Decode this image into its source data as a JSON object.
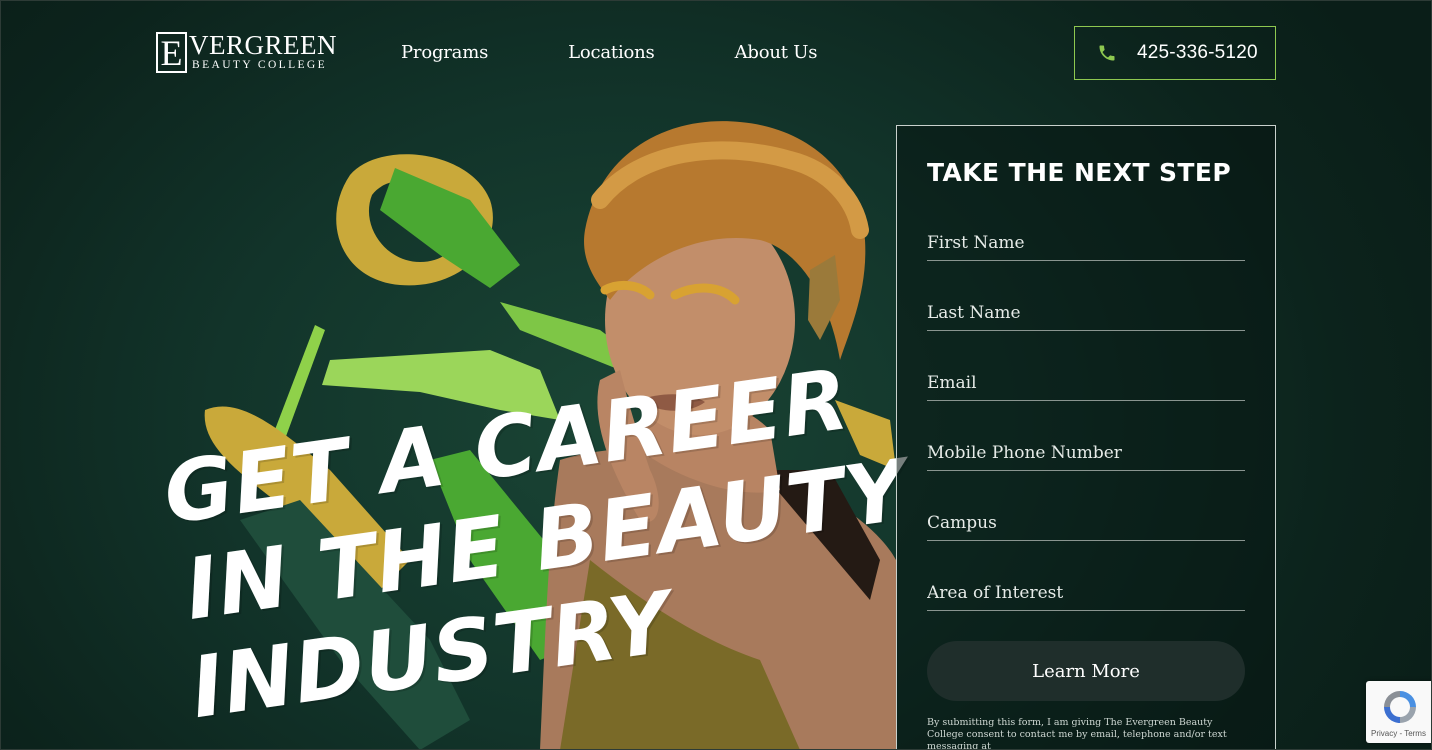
{
  "brand": {
    "logo_initial": "E",
    "logo_main": "VERGREEN",
    "logo_sub": "BEAUTY COLLEGE"
  },
  "nav": {
    "items": [
      "Programs",
      "Locations",
      "About Us"
    ]
  },
  "phone": {
    "icon": "phone-icon",
    "number": "425-336-5120"
  },
  "hero": {
    "headline_line1": "GET A CAREER",
    "headline_line2": "IN THE BEAUTY",
    "headline_line3": "INDUSTRY"
  },
  "form": {
    "title": "TAKE THE NEXT STEP",
    "fields": [
      {
        "placeholder": "First Name"
      },
      {
        "placeholder": "Last Name"
      },
      {
        "placeholder": "Email"
      },
      {
        "placeholder": "Mobile Phone Number"
      },
      {
        "placeholder": "Campus"
      },
      {
        "placeholder": "Area of Interest"
      }
    ],
    "submit_label": "Learn More",
    "disclaimer": "By submitting this form, I am giving The Evergreen Beauty College consent to contact me by email, telephone and/or text messaging at"
  },
  "recaptcha": {
    "terms": "Privacy - Terms"
  },
  "colors": {
    "background": "#0f2a22",
    "accent_green": "#8ec850",
    "gold": "#c8a83a",
    "button": "#1f2e2b"
  }
}
